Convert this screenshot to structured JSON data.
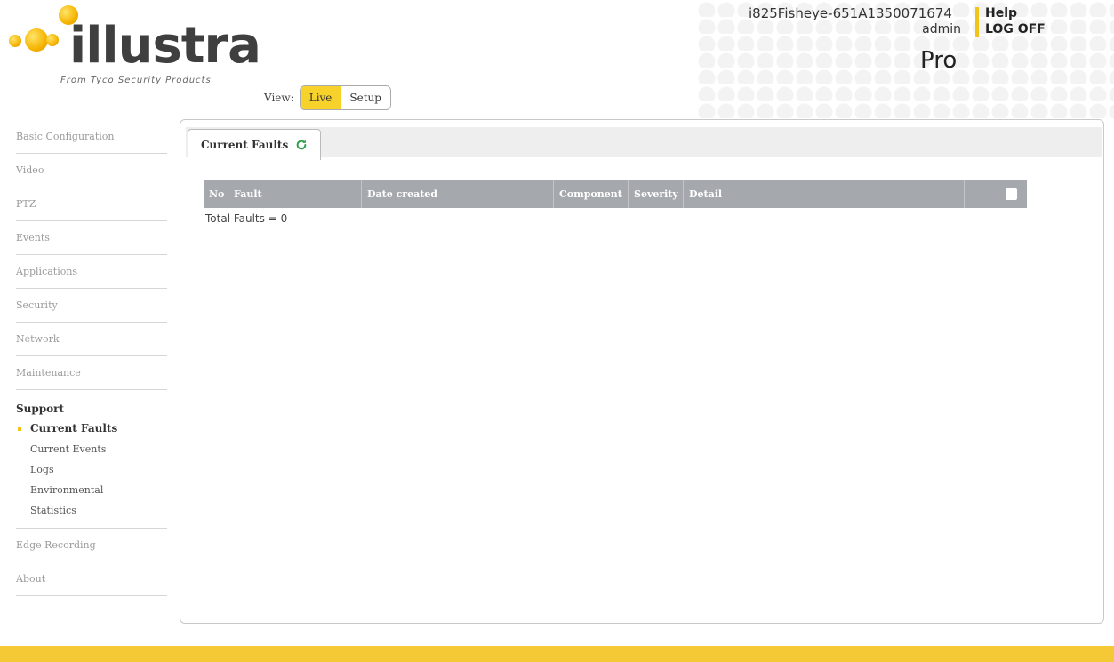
{
  "header": {
    "logo_text": "illustra",
    "logo_tagline": "From Tyco Security Products",
    "device_name": "i825Fisheye-651A1350071674",
    "user": "admin",
    "edition": "Pro",
    "help_label": "Help",
    "logoff_label": "LOG OFF",
    "view_label": "View:",
    "view_options": [
      "Live",
      "Setup"
    ],
    "active_view": "Live",
    "accent_color": "#f0c419"
  },
  "sidebar": {
    "items": [
      "Basic Configuration",
      "Video",
      "PTZ",
      "Events",
      "Applications",
      "Security",
      "Network",
      "Maintenance"
    ],
    "group": {
      "title": "Support",
      "items": [
        "Current Faults",
        "Current Events",
        "Logs",
        "Environmental",
        "Statistics"
      ],
      "active": "Current Faults"
    },
    "after_items": [
      "Edge Recording",
      "About"
    ]
  },
  "main": {
    "tab_label": "Current Faults",
    "columns": [
      "No",
      "Fault",
      "Date created",
      "Component",
      "Severity",
      "Detail"
    ],
    "total_text": "Total Faults = 0"
  }
}
